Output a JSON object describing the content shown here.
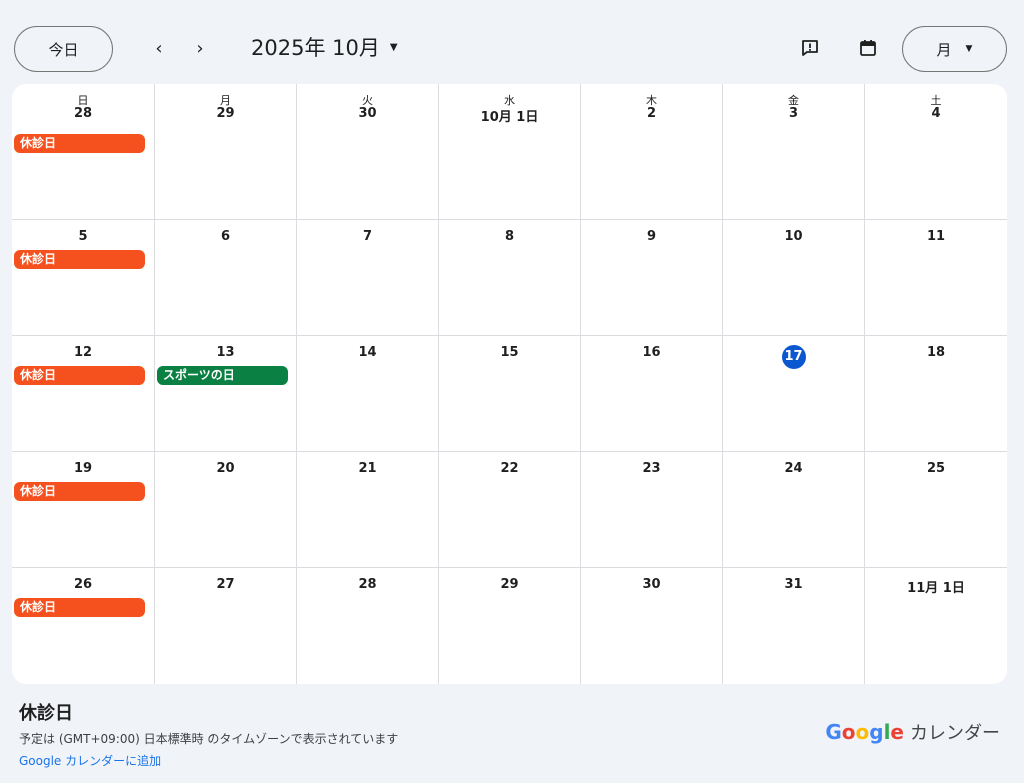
{
  "toolbar": {
    "today_label": "今日",
    "prev_label": "‹",
    "next_label": "›",
    "month_title": "2025年 10月",
    "view_label": "月"
  },
  "weekdays": [
    "日",
    "月",
    "火",
    "水",
    "木",
    "金",
    "土"
  ],
  "weeks": [
    {
      "days": [
        "28",
        "29",
        "30",
        "10月 1日",
        "2",
        "3",
        "4"
      ]
    },
    {
      "days": [
        "5",
        "6",
        "7",
        "8",
        "9",
        "10",
        "11"
      ]
    },
    {
      "days": [
        "12",
        "13",
        "14",
        "15",
        "16",
        "17",
        "18"
      ]
    },
    {
      "days": [
        "19",
        "20",
        "21",
        "22",
        "23",
        "24",
        "25"
      ]
    },
    {
      "days": [
        "26",
        "27",
        "28",
        "29",
        "30",
        "31",
        "11月 1日"
      ]
    }
  ],
  "events": {
    "closed_label": "休診日",
    "holiday_label": "スポーツの日",
    "closed_color": "#f4511e",
    "holiday_color": "#0b8043"
  },
  "today_color": "#0b57d0",
  "footer": {
    "title": "休診日",
    "timezone_note": "予定は (GMT+09:00) 日本標準時 のタイムゾーンで表示されています",
    "add_link": "Google カレンダーに追加",
    "brand_letters": [
      "G",
      "o",
      "o",
      "g",
      "l",
      "e"
    ],
    "brand_colors": [
      "#4285f4",
      "#ea4335",
      "#fbbc05",
      "#4285f4",
      "#34a853",
      "#ea4335"
    ],
    "brand_suffix": "カレンダー"
  }
}
